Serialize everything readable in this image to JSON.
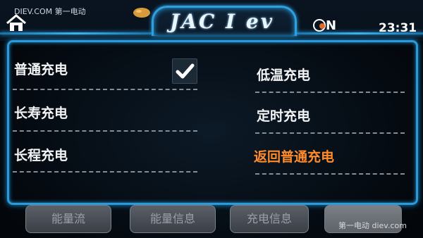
{
  "header": {
    "watermark": "DIEV.COM 第一电动",
    "title": "JAC I ev",
    "on_label": "N",
    "clock": "23:31"
  },
  "options": {
    "left": [
      {
        "label": "普通充电",
        "checked": true
      },
      {
        "label": "长寿充电"
      },
      {
        "label": "长程充电"
      }
    ],
    "right": [
      {
        "label": "低温充电"
      },
      {
        "label": "定时充电"
      },
      {
        "label": "返回普通充电",
        "color": "#ff8b2a"
      }
    ]
  },
  "footer": {
    "buttons": [
      "能量流",
      "能量信息",
      "充电信息",
      ""
    ],
    "watermark": "第一电动 diev.com"
  },
  "colors": {
    "accent": "#2c9ad8",
    "highlight": "#ff8b2a"
  }
}
